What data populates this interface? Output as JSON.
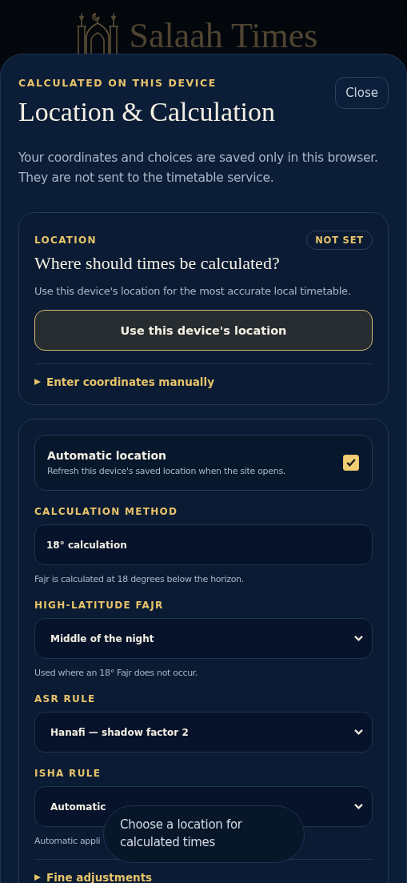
{
  "app": {
    "title": "Salaah Times"
  },
  "sheet": {
    "eyebrow": "CALCULATED ON THIS DEVICE",
    "title": "Location & Calculation",
    "close": "Close",
    "intro": "Your coordinates and choices are saved only in this browser. They are not sent to the timetable service."
  },
  "location_card": {
    "eyebrow": "LOCATION",
    "status": "NOT SET",
    "title": "Where should times be calculated?",
    "text": "Use this device's location for the most accurate local timetable.",
    "button": "Use this device's location",
    "disclosure": {
      "label": "Enter coordinates manually",
      "expanded": false
    }
  },
  "settings_card": {
    "auto_location": {
      "title": "Automatic location",
      "text": "Refresh this device's saved location when the site opens.",
      "checked": true
    },
    "fields": [
      {
        "kind": "input",
        "label": "CALCULATION METHOD",
        "value": "18° calculation",
        "hint": "Fajr is calculated at 18 degrees below the horizon."
      },
      {
        "kind": "select",
        "label": "HIGH-LATITUDE FAJR",
        "value": "Middle of the night",
        "hint": "Used where an 18° Fajr does not occur."
      },
      {
        "kind": "select",
        "label": "ASR RULE",
        "value": "Hanafi — shadow factor 2"
      },
      {
        "kind": "select",
        "label": "ISHA RULE",
        "value": "Automatic",
        "hint": "Automatic appli"
      }
    ],
    "disclosure": {
      "label": "Fine adjustments",
      "expanded": false
    }
  },
  "toast": {
    "text": "Choose a location for calculated times"
  }
}
